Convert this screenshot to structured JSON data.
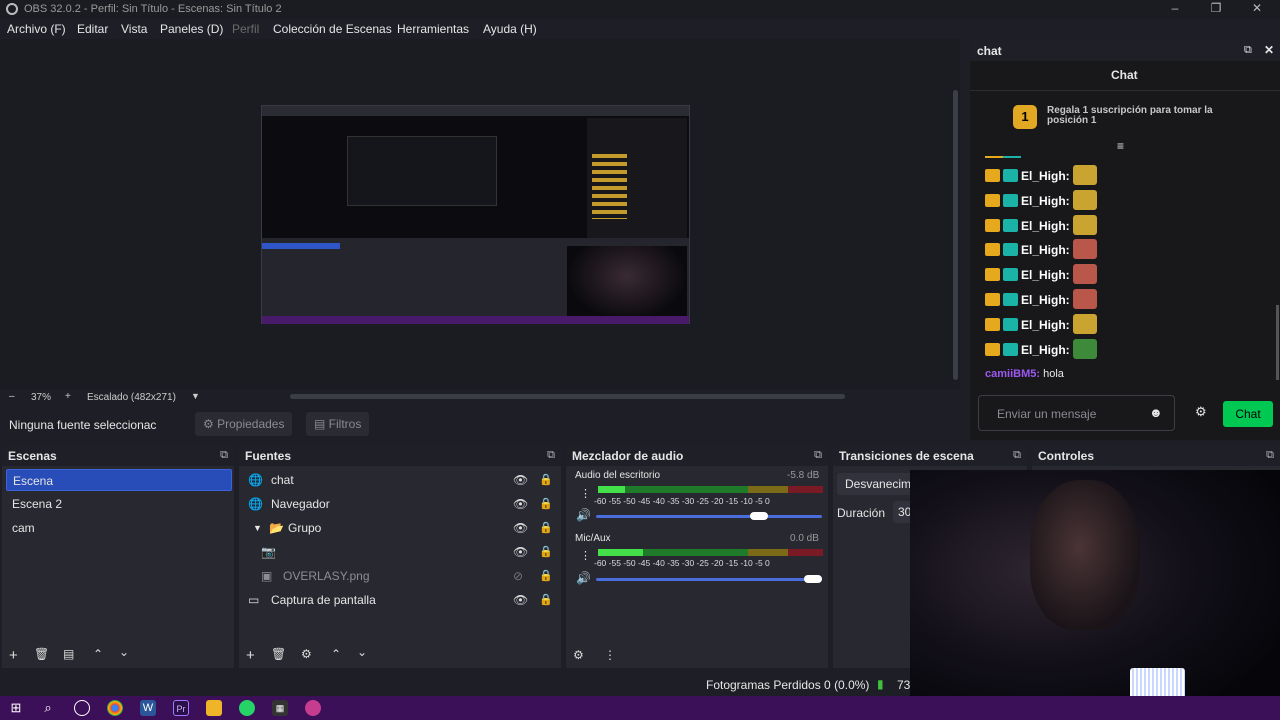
{
  "window": {
    "title": "OBS 32.0.2 - Perfil: Sin Título - Escenas: Sin Título 2"
  },
  "menu": [
    "Archivo (F)",
    "Editar",
    "Vista",
    "Paneles (D)",
    "Perfil",
    "Colección de Escenas",
    "Herramientas",
    "Ayuda (H)"
  ],
  "zoom": {
    "minus": "–",
    "value": "37%",
    "plus": "+",
    "scaling": "Escalado (482x271)"
  },
  "source_toolbar": {
    "no_selection": "Ninguna fuente seleccionac",
    "properties": "Propiedades",
    "filters": "Filtros"
  },
  "scenes": {
    "title": "Escenas",
    "items": [
      "Escena",
      "Escena 2",
      "cam"
    ],
    "selected": "Escena"
  },
  "sources": {
    "title": "Fuentes",
    "items": [
      {
        "name": "chat",
        "icon": "globe-icon"
      },
      {
        "name": "Navegador",
        "icon": "globe-icon"
      },
      {
        "name": "Grupo",
        "icon": "folder-icon"
      },
      {
        "name": "",
        "icon": "camera-icon"
      },
      {
        "name": "OVERLASY.png",
        "icon": "image-icon"
      },
      {
        "name": "Captura de pantalla",
        "icon": "monitor-icon"
      }
    ]
  },
  "mixer": {
    "title": "Mezclador de audio",
    "channels": [
      {
        "name": "Audio del escritorio",
        "db": "-5.8 dB",
        "level": 0.12,
        "volume": 0.76
      },
      {
        "name": "Mic/Aux",
        "db": "0.0 dB",
        "level": 0.2,
        "volume": 1.0
      }
    ],
    "ticks": "-60 -55 -50 -45 -40 -35 -30 -25 -20 -15 -10 -5 0"
  },
  "transitions": {
    "title": "Transiciones de escena",
    "type": "Desvanecim",
    "duration_label": "Duración",
    "duration_value": "30"
  },
  "controls": {
    "title": "Controles"
  },
  "chat": {
    "dock_title": "chat",
    "header": "Chat",
    "gift_count": "1",
    "gift_text": "Regala 1 suscripción para tomar la posición 1",
    "messages": [
      {
        "user": "El_High:",
        "emote": "#c9a431"
      },
      {
        "user": "El_High:",
        "emote": "#c9a431"
      },
      {
        "user": "El_High:",
        "emote": "#c9a431"
      },
      {
        "user": "El_High:",
        "emote": "#b8574a"
      },
      {
        "user": "El_High:",
        "emote": "#b8574a"
      },
      {
        "user": "El_High:",
        "emote": "#b8574a"
      },
      {
        "user": "El_High:",
        "emote": "#c9a431"
      },
      {
        "user": "El_High:",
        "emote": "#3d8a3a"
      }
    ],
    "last_user": "camiiBM5:",
    "last_text": " hola",
    "input_placeholder": "Enviar un mensaje",
    "send": "Chat"
  },
  "status": {
    "dropped": "Fotogramas Perdidos 0 (0.0%)",
    "fps": "73"
  },
  "colors": {
    "accent": "#284cb8",
    "chat_send": "#00c853",
    "username": "#ffffff",
    "last_user": "#9b59f0",
    "taskbar": "#3b1059"
  }
}
